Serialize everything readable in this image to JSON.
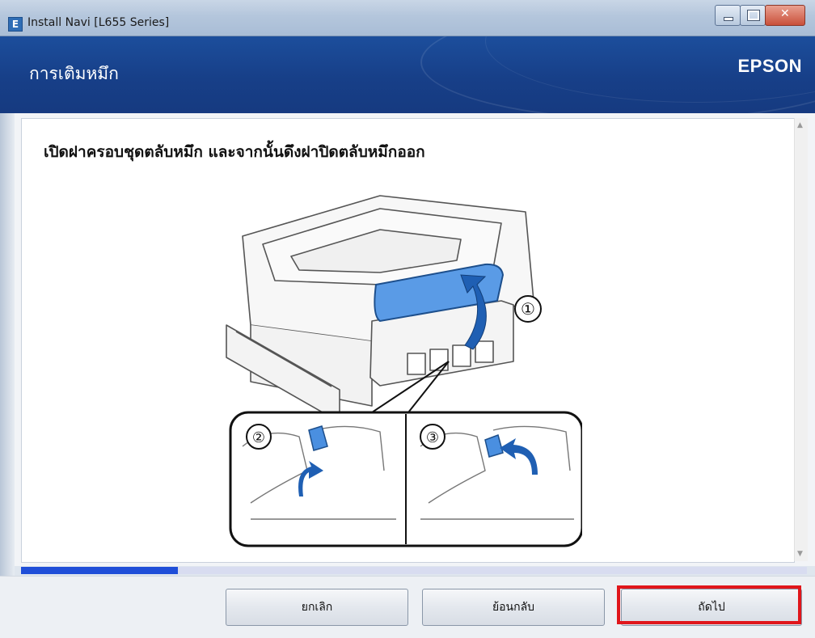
{
  "window": {
    "title": "Install Navi [L655 Series]",
    "app_icon": "E"
  },
  "header": {
    "title": "การเติมหมึก",
    "brand": "EPSON"
  },
  "main": {
    "instruction": "เปิดฝาครอบชุดตลับหมึก และจากนั้นดึงฝาปิดตลับหมึกออก",
    "step_labels": [
      "①",
      "②",
      "③"
    ]
  },
  "progress": {
    "fraction": 0.2,
    "track_color": "#d8dcf0",
    "fill_color": "#1f4ed8"
  },
  "footer": {
    "cancel_label": "ยกเลิก",
    "back_label": "ย้อนกลับ",
    "next_label": "ถัดไป"
  },
  "colors": {
    "header_blue": "#173f88",
    "highlight_red": "#e0161b",
    "cap_blue": "#4a8fe0"
  }
}
